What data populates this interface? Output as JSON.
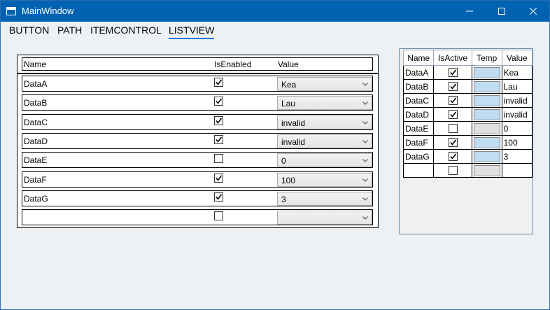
{
  "window": {
    "title": "MainWindow",
    "minimize_icon": "minimize-icon",
    "maximize_icon": "maximize-icon",
    "close_icon": "close-icon"
  },
  "menu": {
    "items": [
      "BUTTON",
      "PATH",
      "ITEMCONTROL",
      "LISTVIEW"
    ],
    "active": "LISTVIEW"
  },
  "listview": {
    "headers": {
      "name": "Name",
      "enabled": "IsEnabled",
      "value": "Value"
    },
    "rows": [
      {
        "name": "DataA",
        "enabled": true,
        "value": "Kea"
      },
      {
        "name": "DataB",
        "enabled": true,
        "value": "Lau"
      },
      {
        "name": "DataC",
        "enabled": true,
        "value": "invalid"
      },
      {
        "name": "DataD",
        "enabled": true,
        "value": "invalid"
      },
      {
        "name": "DataE",
        "enabled": false,
        "value": "0"
      },
      {
        "name": "DataF",
        "enabled": true,
        "value": "100"
      },
      {
        "name": "DataG",
        "enabled": true,
        "value": "3"
      },
      {
        "name": "",
        "enabled": false,
        "value": ""
      }
    ]
  },
  "datagrid": {
    "headers": {
      "name": "Name",
      "active": "IsActive",
      "temp": "Temp",
      "value": "Value"
    },
    "rows": [
      {
        "name": "DataA",
        "active": true,
        "temp": "#c0dcf0",
        "value": "Kea"
      },
      {
        "name": "DataB",
        "active": true,
        "temp": "#c0dcf0",
        "value": "Lau"
      },
      {
        "name": "DataC",
        "active": true,
        "temp": "#c0dcf0",
        "value": "invalid"
      },
      {
        "name": "DataD",
        "active": true,
        "temp": "#c0dcf0",
        "value": "invalid"
      },
      {
        "name": "DataE",
        "active": false,
        "temp": "#e0e0e0",
        "value": "0"
      },
      {
        "name": "DataF",
        "active": true,
        "temp": "#c0dcf0",
        "value": "100"
      },
      {
        "name": "DataG",
        "active": true,
        "temp": "#c0dcf0",
        "value": "3"
      },
      {
        "name": "",
        "active": false,
        "temp": "#e0e0e0",
        "value": ""
      }
    ]
  },
  "colors": {
    "titlebar": "#0063b1",
    "accent": "#0078d7"
  }
}
